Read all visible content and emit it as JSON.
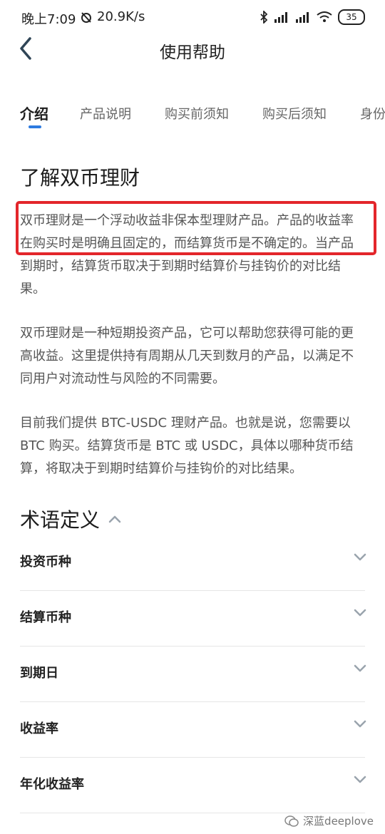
{
  "status_bar": {
    "time": "晚上7:09",
    "net_speed": "20.9K/s",
    "battery": "35",
    "icons": [
      "alarm-icon",
      "bluetooth-icon",
      "signal-icon",
      "wifi-icon",
      "battery-icon"
    ]
  },
  "header": {
    "title": "使用帮助",
    "back_icon": "chevron-left-icon"
  },
  "tabs": [
    {
      "label": "介绍",
      "active": true
    },
    {
      "label": "产品说明",
      "active": false
    },
    {
      "label": "购买前须知",
      "active": false
    },
    {
      "label": "购买后须知",
      "active": false
    },
    {
      "label": "身份",
      "active": false
    }
  ],
  "intro": {
    "title": "了解双币理财",
    "paragraphs": [
      "双币理财是一个浮动收益非保本型理财产品。产品的收益率在购买时是明确且固定的，而结算货币是不确定的。当产品到期时，结算货币取决于到期时结算价与挂钩价的对比结果。",
      "双币理财是一种短期投资产品，它可以帮助您获得可能的更高收益。这里提供持有周期从几天到数月的产品，以满足不同用户对流动性与风险的不同需要。",
      "目前我们提供 BTC-USDC 理财产品。也就是说，您需要以 BTC 购买。结算货币是 BTC 或 USDC，具体以哪种货币结算，将取决于到期时结算价与挂钩价的对比结果。"
    ]
  },
  "terms": {
    "title": "术语定义",
    "items": [
      "投资币种",
      "结算币种",
      "到期日",
      "收益率",
      "年化收益率"
    ]
  },
  "watermark": {
    "text": "深蓝deeplove"
  },
  "colors": {
    "accent": "#2d7be0",
    "highlight": "#e3262b"
  }
}
